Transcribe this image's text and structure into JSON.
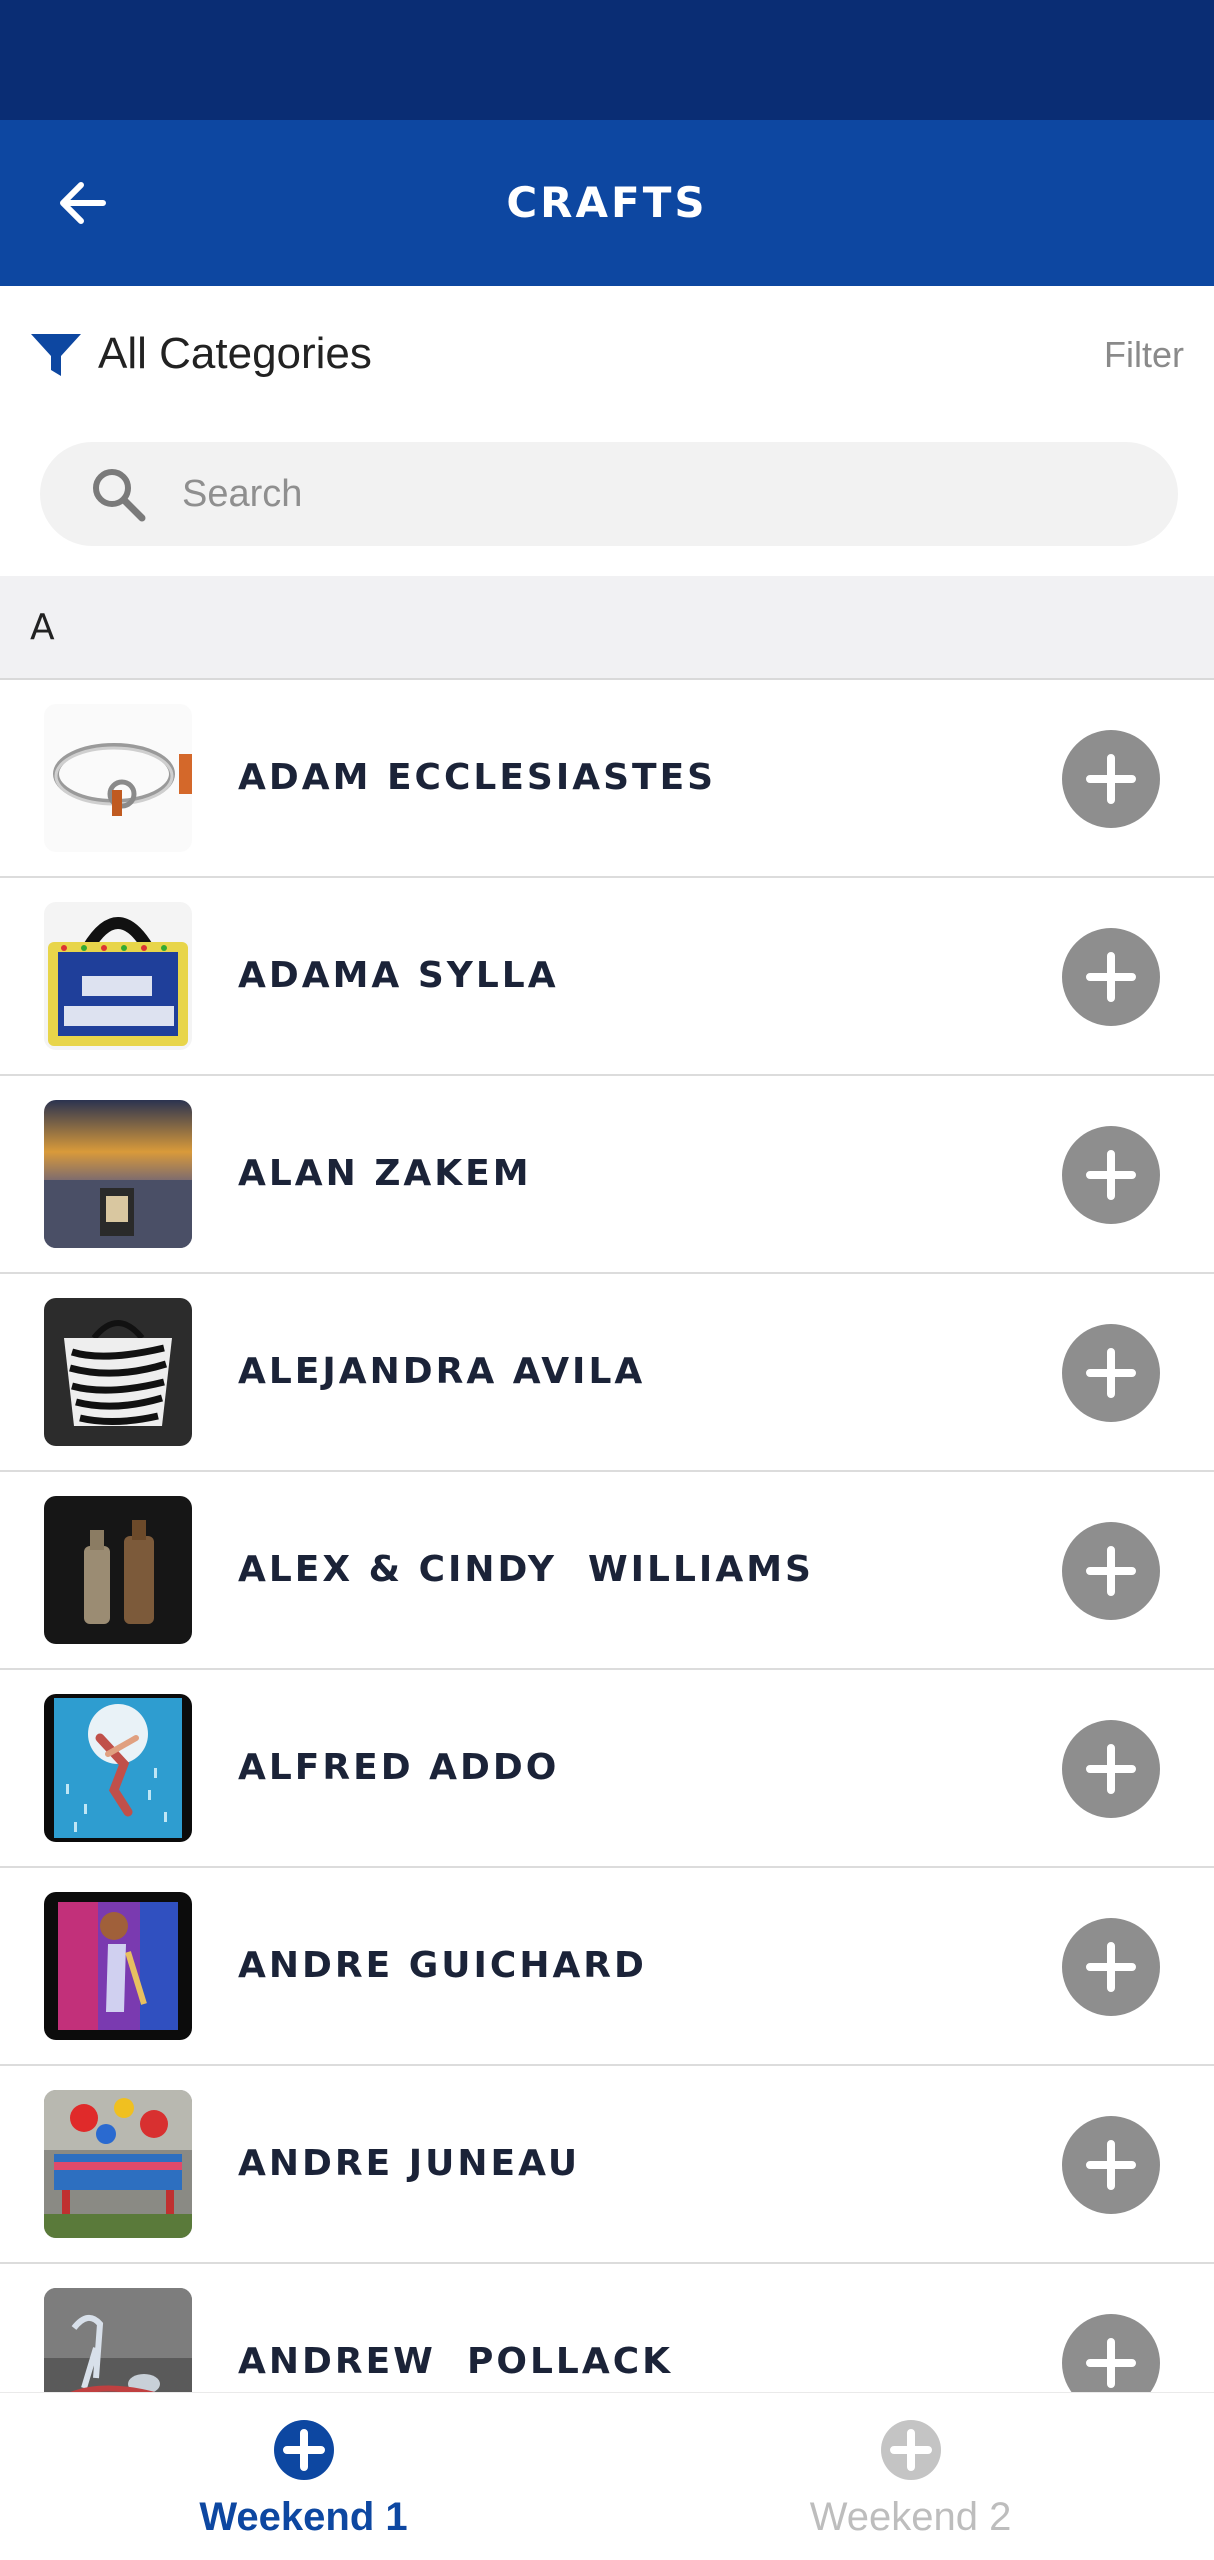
{
  "app": {
    "title": "CRAFTS",
    "brand_color": "#0d47a1",
    "status_color": "#0a2d74"
  },
  "filter": {
    "category": "All Categories",
    "link_label": "Filter",
    "icon": "filter-icon"
  },
  "search": {
    "placeholder": "Search",
    "value": ""
  },
  "section": {
    "letter": "A"
  },
  "artists": [
    {
      "name": "ADAM ECCLESIASTES",
      "thumb": "bracelet"
    },
    {
      "name": "ADAMA SYLLA",
      "thumb": "plate-bag"
    },
    {
      "name": "ALAN ZAKEM",
      "thumb": "cityscape"
    },
    {
      "name": "ALEJANDRA AVILA",
      "thumb": "zebra-bag"
    },
    {
      "name": "ALEX & CINDY  WILLIAMS",
      "thumb": "bottles"
    },
    {
      "name": "ALFRED ADDO",
      "thumb": "blue-painting"
    },
    {
      "name": "ANDRE GUICHARD",
      "thumb": "sax-painting"
    },
    {
      "name": "ANDRE JUNEAU",
      "thumb": "bench"
    },
    {
      "name": "ANDREW  POLLACK",
      "thumb": "birds"
    }
  ],
  "bottom_nav": {
    "tabs": [
      {
        "label": "Weekend 1",
        "active": true
      },
      {
        "label": "Weekend 2",
        "active": false
      }
    ]
  }
}
